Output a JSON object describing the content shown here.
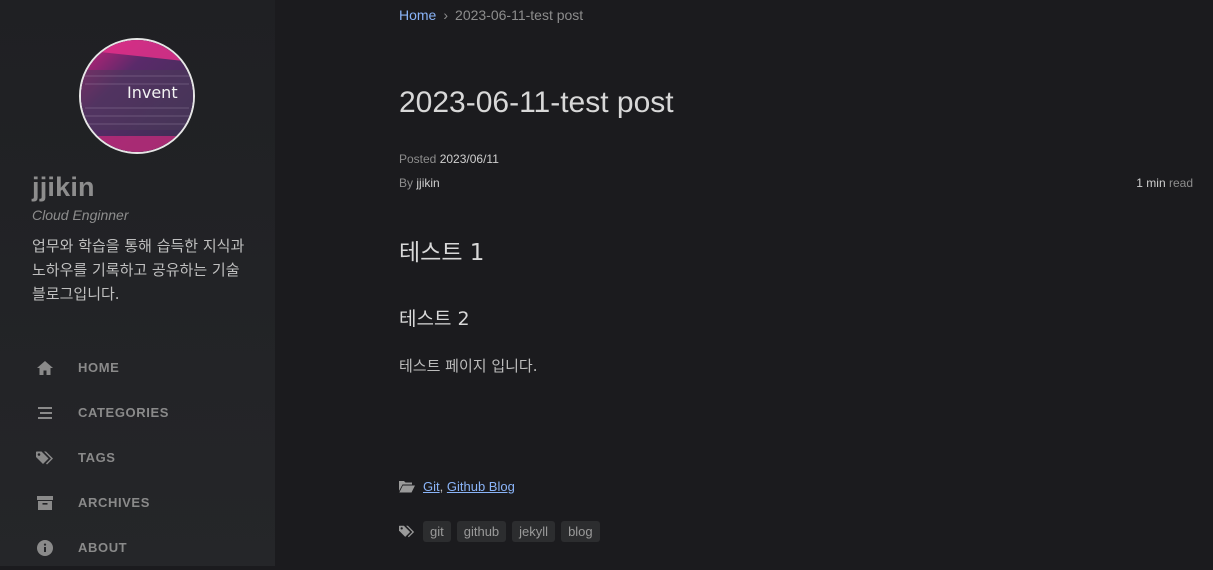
{
  "sidebar": {
    "title": "jjikin",
    "subtitle": "Cloud Enginner",
    "description": "업무와 학습을 통해 습득한 지식과 노하우를 기록하고 공유하는 기술 블로그입니다.",
    "avatar_text": "Invent",
    "nav": [
      {
        "label": "HOME",
        "icon": "home-icon"
      },
      {
        "label": "CATEGORIES",
        "icon": "stream-icon"
      },
      {
        "label": "TAGS",
        "icon": "tags-icon"
      },
      {
        "label": "ARCHIVES",
        "icon": "archive-icon"
      },
      {
        "label": "ABOUT",
        "icon": "info-icon"
      }
    ]
  },
  "breadcrumb": {
    "home": "Home",
    "separator": "›",
    "current": "2023-06-11-test post"
  },
  "post": {
    "title": "2023-06-11-test post",
    "posted_label": "Posted",
    "posted_date": "2023/06/11",
    "by_label": "By",
    "author": "jjikin",
    "read_value": "1 min",
    "read_label": "read",
    "heading1": "테스트 1",
    "heading2": "테스트 2",
    "paragraph": "테스트 페이지 입니다.",
    "categories": [
      "Git",
      "Github Blog"
    ],
    "category_separator": ",",
    "tags": [
      "git",
      "github",
      "jekyll",
      "blog"
    ]
  },
  "colors": {
    "background": "#1b1b1e",
    "sidebar": "#1f2023",
    "link": "#8ab4f8",
    "nav_text": "#8a8a8a"
  }
}
